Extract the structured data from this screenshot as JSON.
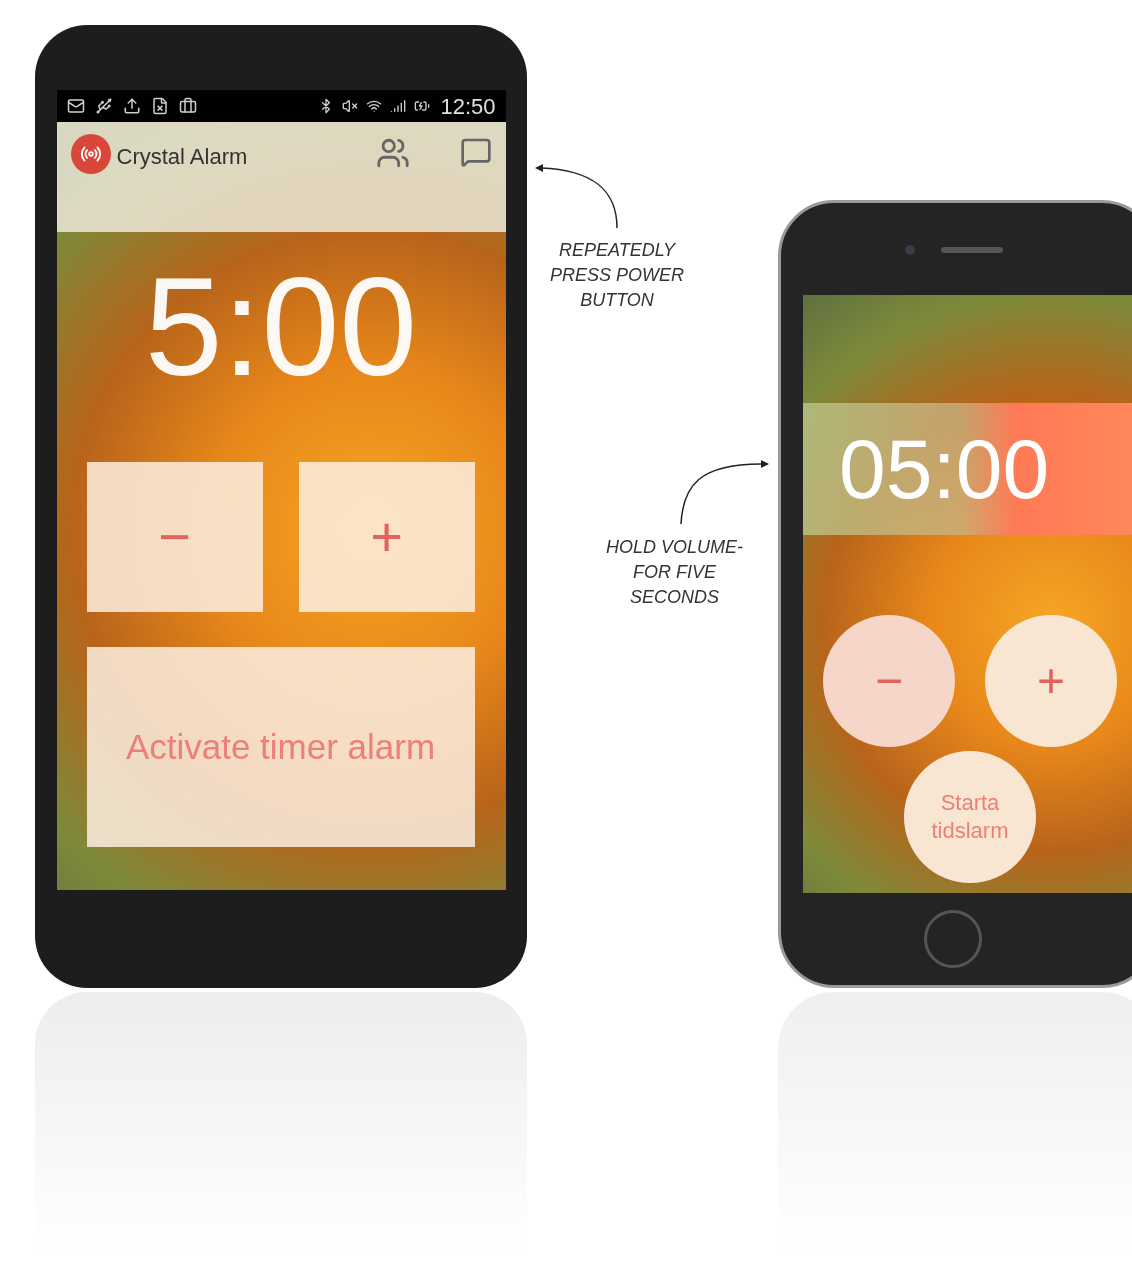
{
  "android": {
    "status_bar": {
      "time": "12:50"
    },
    "app_bar": {
      "title": "Crystal Alarm"
    },
    "timer": "5:00",
    "buttons": [
      "−",
      "+"
    ],
    "activate_button": "Activate timer alarm"
  },
  "annotations": [
    "REPEATEDLY PRESS POWER BUTTON",
    "HOLD VOLUME- FOR FIVE SECONDS"
  ],
  "iphone": {
    "timer": "05:00",
    "buttons": [
      "−",
      "+"
    ],
    "start_button": "Starta tidslarm"
  }
}
